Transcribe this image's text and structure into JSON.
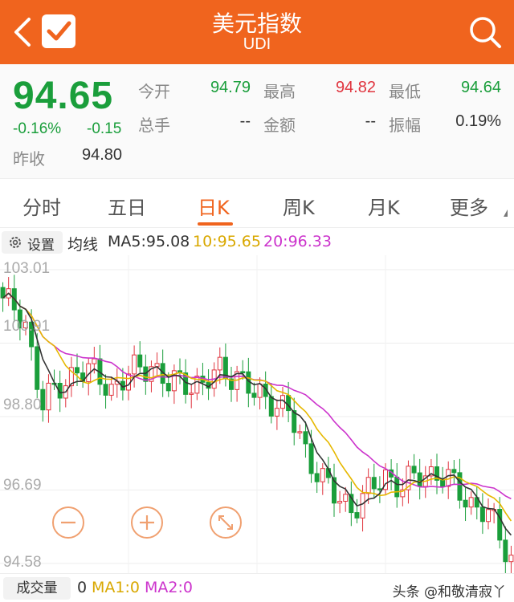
{
  "header": {
    "title": "美元指数",
    "subtitle": "UDI"
  },
  "quote": {
    "price": "94.65",
    "change_pct": "-0.16%",
    "change_abs": "-0.15",
    "prev_close_label": "昨收",
    "prev_close": "94.80",
    "stats": [
      {
        "label": "今开",
        "value": "94.79",
        "color": "green"
      },
      {
        "label": "最高",
        "value": "94.82",
        "color": "red"
      },
      {
        "label": "最低",
        "value": "94.64",
        "color": "green"
      },
      {
        "label": "总手",
        "value": "--",
        "color": "dark"
      },
      {
        "label": "金额",
        "value": "--",
        "color": "dark"
      },
      {
        "label": "振幅",
        "value": "0.19%",
        "color": "dark"
      }
    ]
  },
  "tabs": [
    "分时",
    "五日",
    "日K",
    "周K",
    "月K",
    "更多"
  ],
  "active_tab": "日K",
  "ma": {
    "settings_label": "设置",
    "label": "均线",
    "ma5": "MA5:95.08",
    "ma10": "10:95.65",
    "ma20": "20:96.33"
  },
  "chart": {
    "y_labels": [
      "103.01",
      "100.91",
      "98.80",
      "96.69",
      "94.58"
    ],
    "ylim": [
      94.58,
      103.01
    ]
  },
  "volume": {
    "button_label": "成交量",
    "value": "0",
    "ma1": "MA1:0",
    "ma2": "MA2:0"
  },
  "watermark": "头条 @和敬清寂丫",
  "colors": {
    "brand": "#f0641e",
    "up": "#e0343e",
    "down": "#1a9e3b",
    "ma5": "#333333",
    "ma10": "#e6b800",
    "ma20": "#cc33cc"
  }
}
